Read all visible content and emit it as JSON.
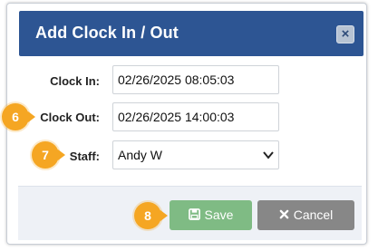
{
  "dialog": {
    "title": "Add Clock In / Out",
    "close_symbol": "×"
  },
  "form": {
    "clock_in_label": "Clock In:",
    "clock_in_value": "02/26/2025 08:05:03",
    "clock_out_label": "Clock Out:",
    "clock_out_value": "02/26/2025 14:00:03",
    "staff_label": "Staff:",
    "staff_value": "Andy W"
  },
  "footer": {
    "save_label": "Save",
    "cancel_label": "Cancel"
  },
  "callouts": {
    "six": "6",
    "seven": "7",
    "eight": "8"
  },
  "colors": {
    "header": "#2d5593",
    "save": "#7fbb84",
    "cancel": "#878787",
    "callout": "#f5a623"
  },
  "icons": {
    "close": "close-icon",
    "save": "floppy-disk-icon",
    "cancel": "x-icon",
    "dropdown": "chevron-down-icon"
  }
}
